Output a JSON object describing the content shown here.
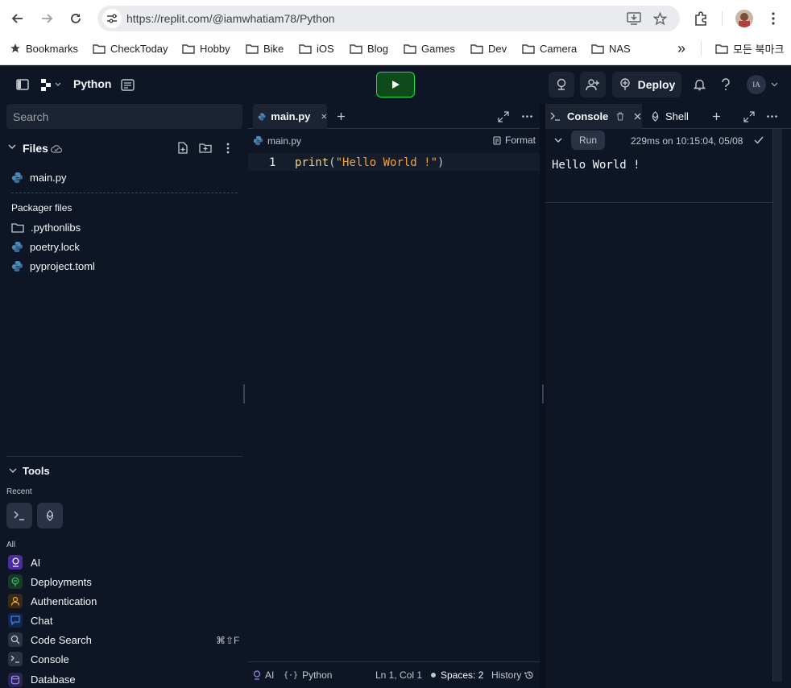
{
  "browser": {
    "url": "https://replit.com/@iamwhatiam78/Python",
    "bookmarks": [
      {
        "label": "Bookmarks",
        "icon": "star-icon"
      },
      {
        "label": "CheckToday",
        "icon": "folder-icon"
      },
      {
        "label": "Hobby",
        "icon": "folder-icon"
      },
      {
        "label": "Bike",
        "icon": "folder-icon"
      },
      {
        "label": "iOS",
        "icon": "folder-icon"
      },
      {
        "label": "Blog",
        "icon": "folder-icon"
      },
      {
        "label": "Games",
        "icon": "folder-icon"
      },
      {
        "label": "Dev",
        "icon": "folder-icon"
      },
      {
        "label": "Camera",
        "icon": "folder-icon"
      },
      {
        "label": "NAS",
        "icon": "folder-icon"
      }
    ],
    "more_bookmarks": "»",
    "all_bookmarks": "모든 북마크"
  },
  "app": {
    "repl_name": "Python",
    "deploy_label": "Deploy",
    "avatar_initials": "IA",
    "accent": "#0ce74c"
  },
  "files": {
    "search_placeholder": "Search",
    "title": "Files",
    "items": [
      {
        "name": "main.py",
        "icon": "python-icon"
      }
    ],
    "packager_label": "Packager files",
    "packager_items": [
      {
        "name": ".pythonlibs",
        "icon": "folder-icon"
      },
      {
        "name": "poetry.lock",
        "icon": "python-icon"
      },
      {
        "name": "pyproject.toml",
        "icon": "python-icon"
      }
    ]
  },
  "tools": {
    "title": "Tools",
    "recent_label": "Recent",
    "all_label": "All",
    "items": [
      {
        "label": "AI",
        "icon": "ai-icon",
        "color": "#7c4dff"
      },
      {
        "label": "Deployments",
        "icon": "deployments-icon",
        "color": "#3ac06d"
      },
      {
        "label": "Authentication",
        "icon": "user-icon",
        "color": "#f2a33c"
      },
      {
        "label": "Chat",
        "icon": "chat-icon",
        "color": "#3b82f6"
      },
      {
        "label": "Code Search",
        "icon": "search-icon",
        "color": "#c2c8cc",
        "shortcut": "⌘⇧F"
      },
      {
        "label": "Console",
        "icon": "console-icon",
        "color": "#c2c8cc"
      },
      {
        "label": "Database",
        "icon": "database-icon",
        "color": "#9b87f5"
      }
    ]
  },
  "editor": {
    "tab_label": "main.py",
    "breadcrumb": "main.py",
    "format_label": "Format",
    "line_number": "1",
    "code": {
      "func": "print",
      "open": "(",
      "string": "\"Hello World !\"",
      "close": ")"
    },
    "status": {
      "ai": "AI",
      "language": "Python",
      "position": "Ln 1, Col 1",
      "spaces": "Spaces: 2",
      "history": "History"
    }
  },
  "console": {
    "tab_console": "Console",
    "tab_shell": "Shell",
    "run_label": "Run",
    "run_info": "229ms on 10:15:04, 05/08",
    "output": "Hello World !"
  }
}
